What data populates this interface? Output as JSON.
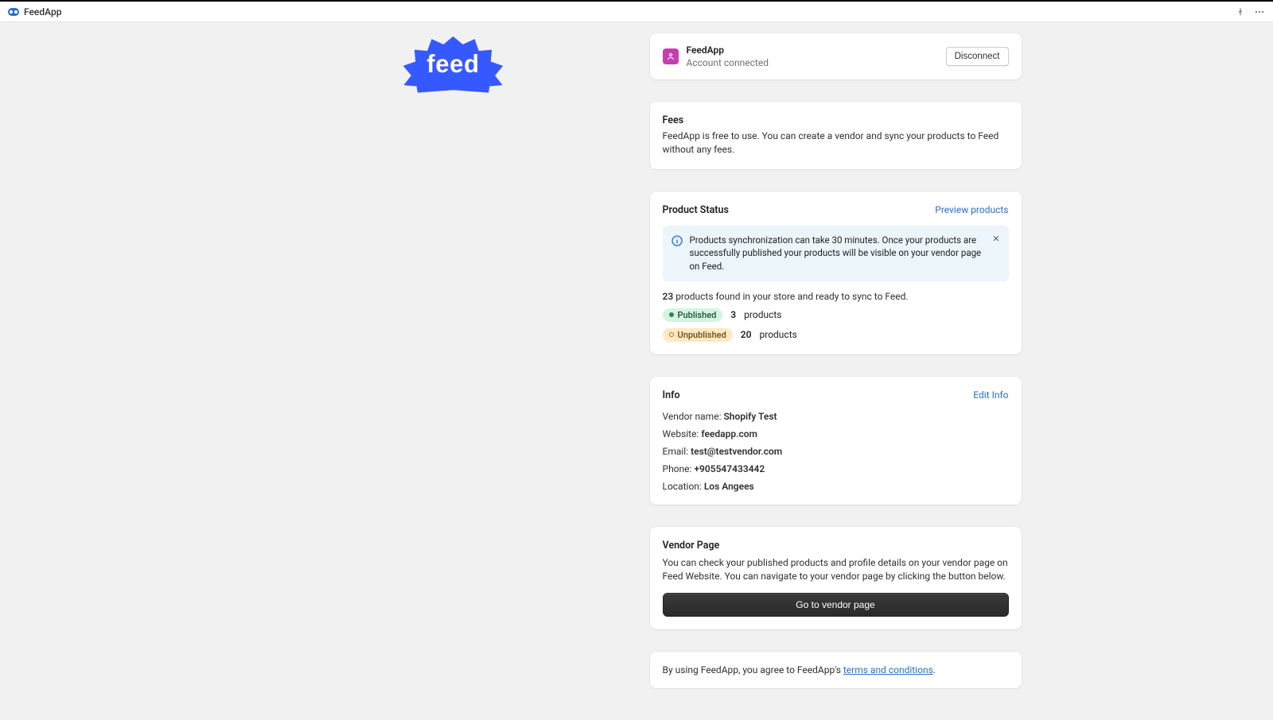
{
  "topbar": {
    "app_name": "FeedApp"
  },
  "account": {
    "name": "FeedApp",
    "status": "Account connected",
    "disconnect_label": "Disconnect"
  },
  "fees": {
    "title": "Fees",
    "body": "FeedApp is free to use. You can create a vendor and sync your products to Feed without any fees."
  },
  "product_status": {
    "title": "Product Status",
    "preview_label": "Preview products",
    "banner": "Products synchronization can take 30 minutes. Once your products are successfully published your products will be visible on your vendor page on Feed.",
    "total_count": "23",
    "total_suffix": " products found in your store and ready to sync to Feed.",
    "published": {
      "label": "Published",
      "count": "3",
      "suffix": "products"
    },
    "unpublished": {
      "label": "Unpublished",
      "count": "20",
      "suffix": "products"
    }
  },
  "info": {
    "title": "Info",
    "edit_label": "Edit Info",
    "vendor_label": "Vendor name: ",
    "vendor_value": "Shopify Test",
    "website_label": "Website: ",
    "website_value": "feedapp.com",
    "email_label": "Email: ",
    "email_value": "test@testvendor.com",
    "phone_label": "Phone: ",
    "phone_value": "+905547433442",
    "location_label": "Location: ",
    "location_value": "Los Angees"
  },
  "vendor_page": {
    "title": "Vendor Page",
    "body": "You can check your published products and profile details on your vendor page on Feed Website. You can navigate to your vendor page by clicking the button below.",
    "button_label": "Go to vendor page"
  },
  "terms": {
    "prefix": "By using FeedApp, you agree to FeedApp's ",
    "link": "terms and conditions",
    "suffix": "."
  }
}
